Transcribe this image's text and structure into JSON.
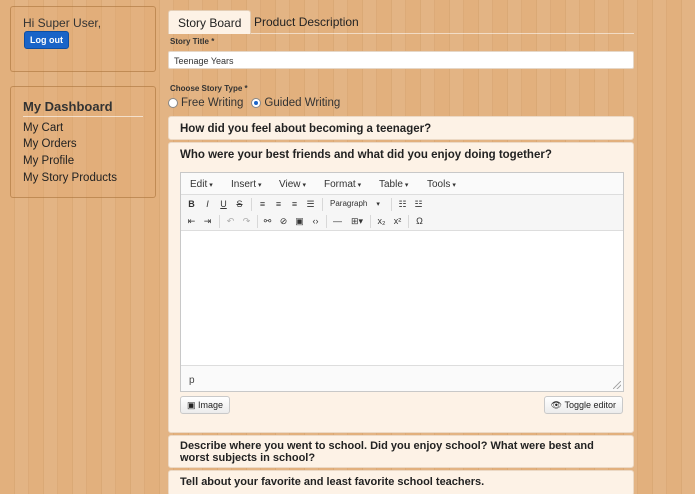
{
  "sidebar": {
    "greeting": "Hi Super User,",
    "logout_label": "Log out",
    "dashboard_title": "My Dashboard",
    "links": [
      "My Cart",
      "My Orders",
      "My Profile",
      "My Story Products"
    ]
  },
  "tabs": [
    "Story Board",
    "Product Description"
  ],
  "form": {
    "story_title_label": "Story Title *",
    "story_title_value": "Teenage Years",
    "story_type_label": "Choose Story Type *",
    "story_types": [
      "Free Writing",
      "Guided Writing"
    ],
    "selected_type": "Guided Writing"
  },
  "questions": [
    "How did you feel about becoming a teenager?",
    "Who were your best friends and what did you enjoy doing together?",
    "Describe where you went to school. Did you enjoy school? What were best and worst subjects in school?",
    "Tell about your favorite and least favorite school teachers."
  ],
  "editor": {
    "menus": [
      "Edit",
      "Insert",
      "View",
      "Format",
      "Table",
      "Tools"
    ],
    "toolbar_row1": [
      "B",
      "I",
      "U",
      "S"
    ],
    "paragraph_select": "Paragraph",
    "status_path": "p",
    "image_button": "Image",
    "toggle_button": "Toggle editor",
    "icons": [
      "align-left-icon",
      "align-center-icon",
      "align-right-icon",
      "justify-icon",
      "bullet-list-icon",
      "numbered-list-icon",
      "outdent-icon",
      "indent-icon",
      "undo-icon",
      "redo-icon",
      "link-icon",
      "unlink-icon",
      "image-icon",
      "code-icon",
      "horizontal-rule-icon",
      "table-icon",
      "subscript-icon",
      "superscript-icon",
      "special-char-icon",
      "eye-icon"
    ]
  },
  "colors": {
    "background": "#e2b07d",
    "logout_button": "#1a64c8",
    "card": "#fdf2e6"
  }
}
